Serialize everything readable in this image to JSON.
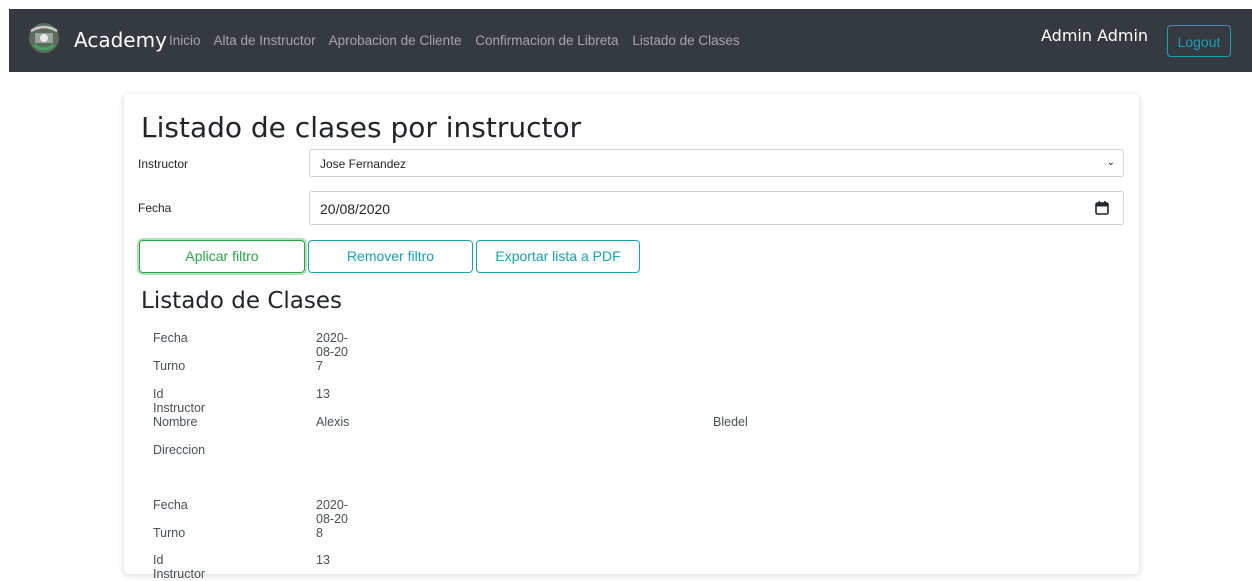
{
  "navbar": {
    "brand": "Academy",
    "links": [
      "Inicio",
      "Alta de Instructor",
      "Aprobacion de Cliente",
      "Confirmacion de Libreta",
      "Listado de Clases"
    ],
    "user": "Admin Admin",
    "logout": "Logout"
  },
  "filter": {
    "title": "Listado de clases por instructor",
    "instructor_label": "Instructor",
    "instructor_value": "Jose Fernandez",
    "fecha_label": "Fecha",
    "fecha_value": "20/08/2020",
    "apply": "Aplicar filtro",
    "remove": "Remover filtro",
    "export": "Exportar lista a PDF"
  },
  "list": {
    "title": "Listado de Clases",
    "labels": {
      "fecha": "Fecha",
      "turno": "Turno",
      "id": "Id Instructor",
      "nombre": "Nombre",
      "direccion": "Direccion"
    },
    "items": [
      {
        "fecha": "2020-08-20",
        "turno": "7",
        "id": "13",
        "nombre": "Alexis",
        "apellido": "Bledel",
        "direccion": ""
      },
      {
        "fecha": "2020-08-20",
        "turno": "8",
        "id": "13"
      }
    ]
  }
}
